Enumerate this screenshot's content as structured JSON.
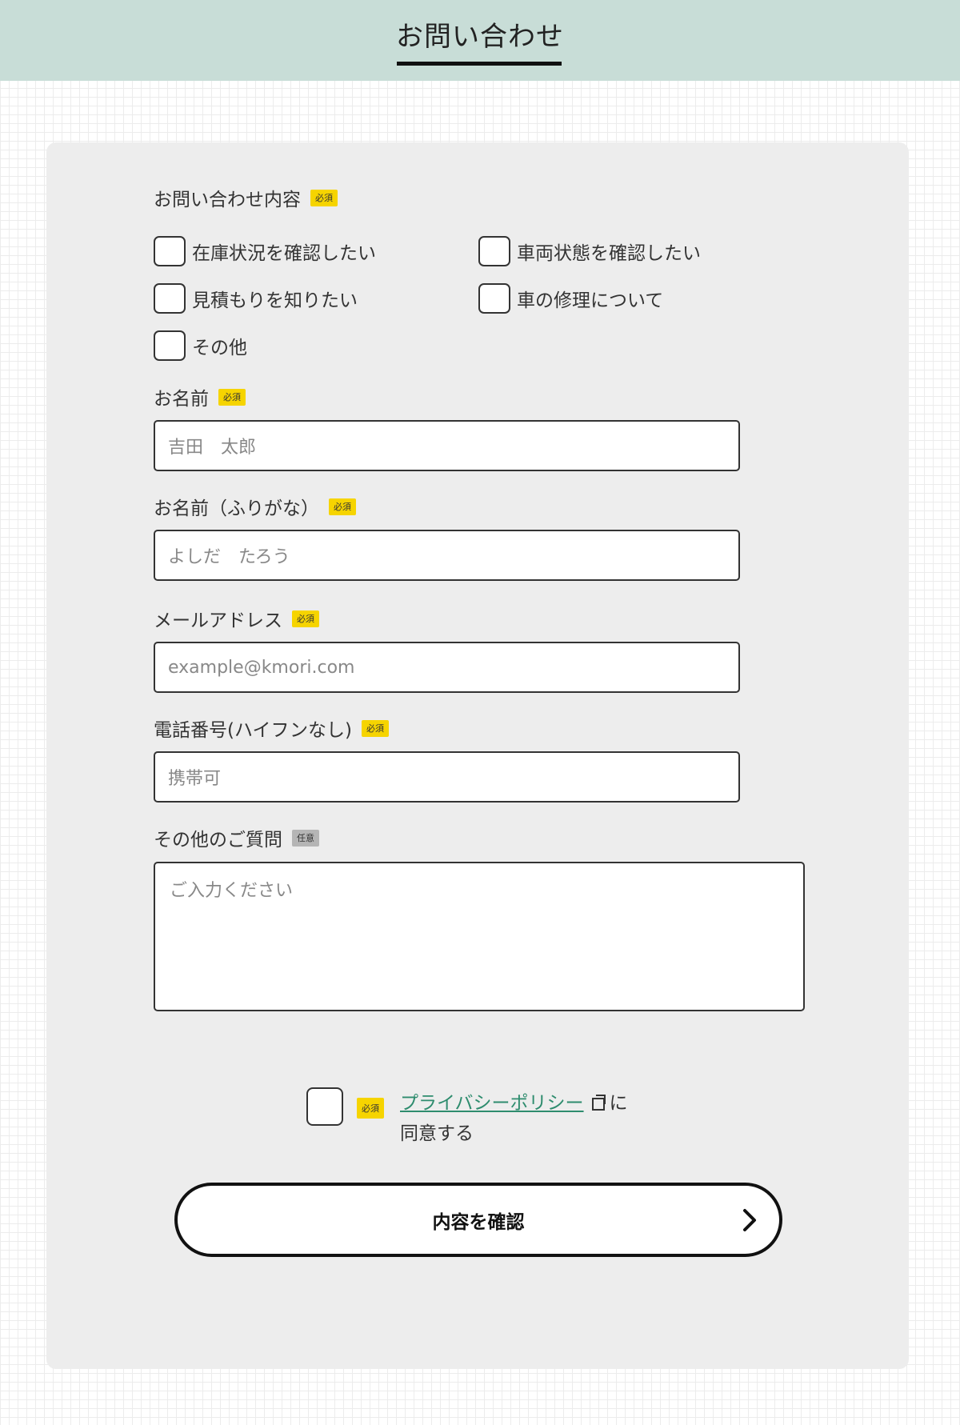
{
  "header": {
    "title": "お問い合わせ"
  },
  "required_badge": "必須",
  "optional_badge": "任意",
  "inquiry": {
    "label": "お問い合わせ内容",
    "options": [
      "在庫状況を確認したい",
      "車両状態を確認したい",
      "見積もりを知りたい",
      "車の修理について",
      "その他"
    ]
  },
  "name": {
    "label": "お名前",
    "placeholder": "吉田　太郎"
  },
  "kana": {
    "label": "お名前（ふりがな）",
    "placeholder": "よしだ　たろう"
  },
  "email": {
    "label": "メールアドレス",
    "placeholder": "example@kmori.com"
  },
  "phone": {
    "label": "電話番号(ハイフンなし)",
    "placeholder": "携帯可"
  },
  "questions": {
    "label": "その他のご質問",
    "placeholder": "ご入力ください"
  },
  "privacy": {
    "link": "プライバシーポリシー",
    "suffix": "に",
    "line2": "同意する"
  },
  "submit": {
    "label": "内容を確認"
  }
}
